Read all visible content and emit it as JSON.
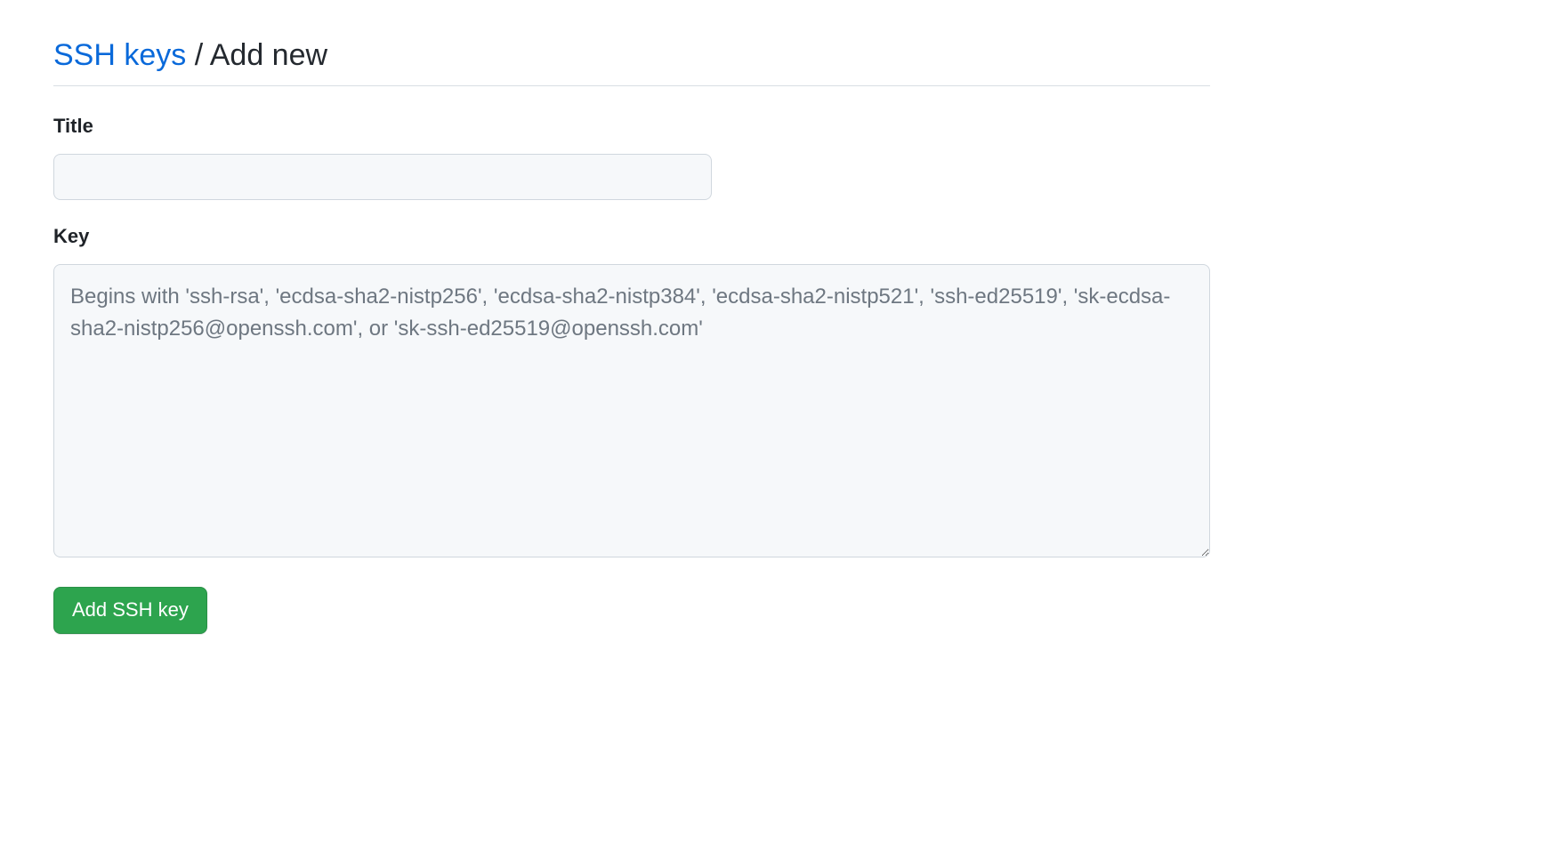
{
  "header": {
    "link_label": "SSH keys",
    "separator": " / ",
    "current_label": "Add new"
  },
  "form": {
    "title": {
      "label": "Title",
      "value": ""
    },
    "key": {
      "label": "Key",
      "value": "",
      "placeholder": "Begins with 'ssh-rsa', 'ecdsa-sha2-nistp256', 'ecdsa-sha2-nistp384', 'ecdsa-sha2-nistp521', 'ssh-ed25519', 'sk-ecdsa-sha2-nistp256@openssh.com', or 'sk-ssh-ed25519@openssh.com'"
    },
    "submit_label": "Add SSH key"
  }
}
